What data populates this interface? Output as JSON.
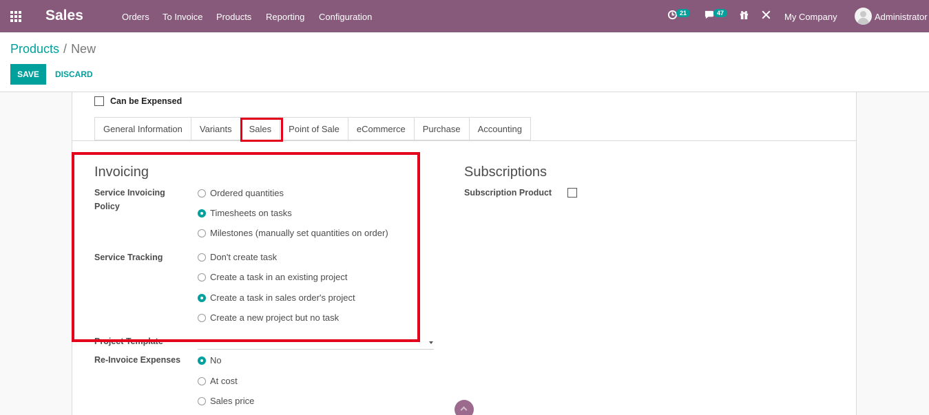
{
  "navbar": {
    "app_title": "Sales",
    "menu": [
      "Orders",
      "To Invoice",
      "Products",
      "Reporting",
      "Configuration"
    ],
    "activity_count": "21",
    "messages_count": "47",
    "company": "My Company",
    "user": "Administrator"
  },
  "breadcrumb": {
    "parent": "Products",
    "separator": "/",
    "current": "New"
  },
  "buttons": {
    "save": "Save",
    "discard": "Discard"
  },
  "form": {
    "can_be_expensed_label": "Can be Expensed",
    "tabs": [
      "General Information",
      "Variants",
      "Sales",
      "Point of Sale",
      "eCommerce",
      "Purchase",
      "Accounting"
    ],
    "active_tab": "Sales",
    "invoicing": {
      "title": "Invoicing",
      "service_invoicing_policy": {
        "label": "Service Invoicing Policy",
        "options": [
          "Ordered quantities",
          "Timesheets on tasks",
          "Milestones (manually set quantities on order)"
        ],
        "selected": "Timesheets on tasks"
      },
      "service_tracking": {
        "label": "Service Tracking",
        "options": [
          "Don't create task",
          "Create a task in an existing project",
          "Create a task in sales order's project",
          "Create a new project but no task"
        ],
        "selected": "Create a task in sales order's project"
      },
      "project_template_label": "Project Template",
      "reinvoice_expenses": {
        "label": "Re-Invoice Expenses",
        "options": [
          "No",
          "At cost",
          "Sales price"
        ],
        "selected": "No"
      }
    },
    "subscriptions": {
      "title": "Subscriptions",
      "subscription_product_label": "Subscription Product"
    }
  },
  "icons": {
    "apps": "apps-grid-icon",
    "activity": "clock-icon",
    "messages": "chat-icon",
    "gift": "gift-icon",
    "debug": "tools-icon",
    "scroll": "chevron-up-icon"
  },
  "colors": {
    "navbar": "#875a7b",
    "accent": "#00a09d",
    "highlight": "#e3001b"
  }
}
